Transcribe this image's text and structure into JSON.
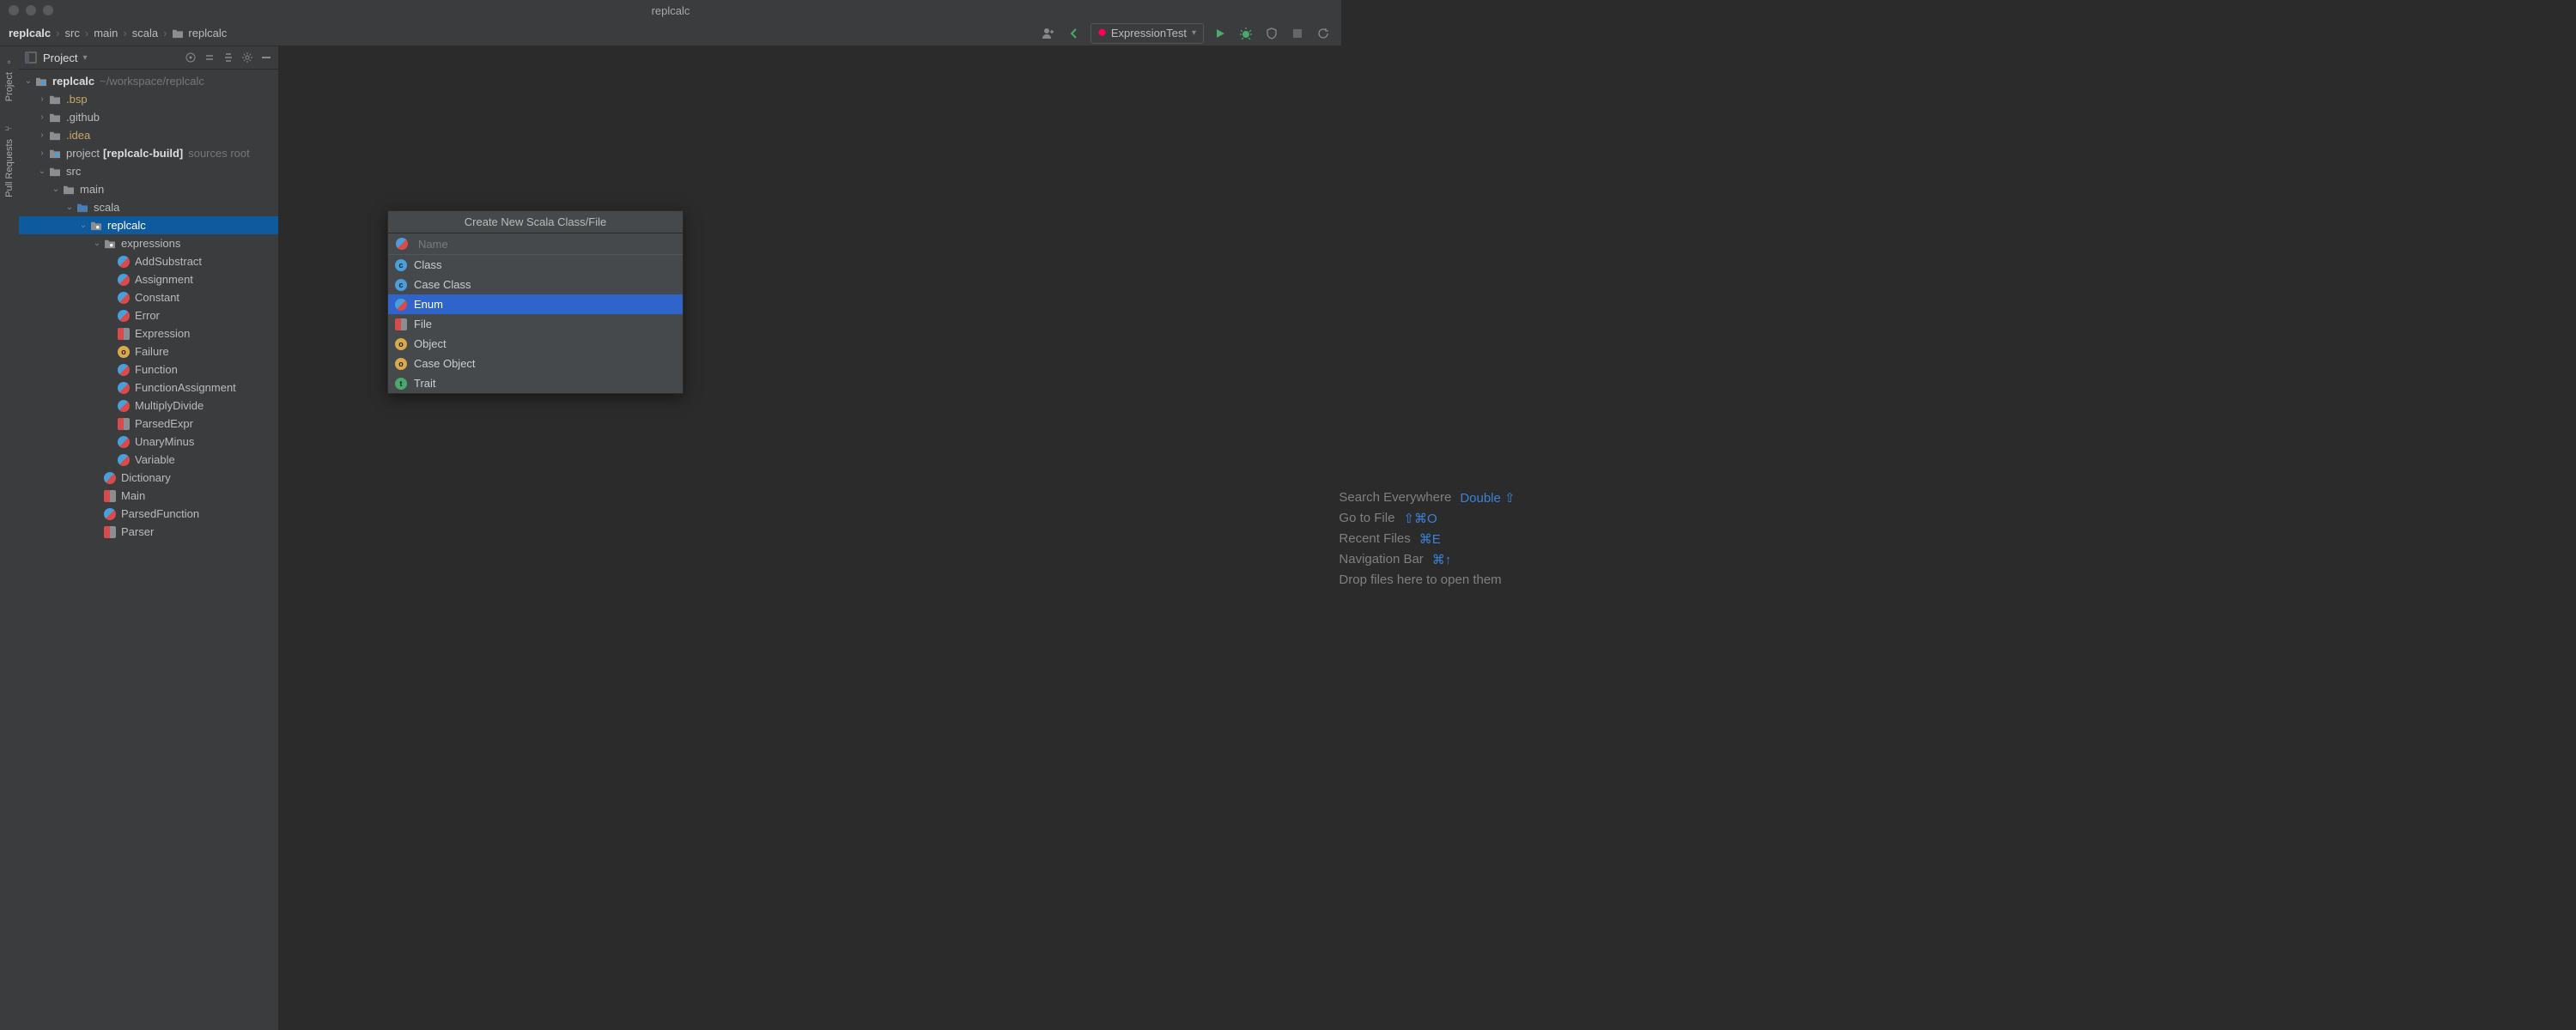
{
  "window": {
    "title": "replcalc"
  },
  "breadcrumb": [
    "replcalc",
    "src",
    "main",
    "scala",
    "replcalc"
  ],
  "run_config": {
    "label": "ExpressionTest"
  },
  "gutter": {
    "project": "Project",
    "pull_requests": "Pull Requests"
  },
  "project_pane": {
    "title": "Project",
    "root": {
      "name": "replcalc",
      "path": "~/workspace/replcalc"
    },
    "nodes": {
      "bsp": ".bsp",
      "github": ".github",
      "idea": ".idea",
      "project": "project",
      "project_bold": "[replcalc-build]",
      "project_hint": "sources root",
      "src": "src",
      "main": "main",
      "scala": "scala",
      "pkg": "replcalc",
      "expressions": "expressions",
      "files": {
        "AddSubstract": "AddSubstract",
        "Assignment": "Assignment",
        "Constant": "Constant",
        "Error": "Error",
        "Expression": "Expression",
        "Failure": "Failure",
        "Function": "Function",
        "FunctionAssignment": "FunctionAssignment",
        "MultiplyDivide": "MultiplyDivide",
        "ParsedExpr": "ParsedExpr",
        "UnaryMinus": "UnaryMinus",
        "Variable": "Variable"
      },
      "Dictionary": "Dictionary",
      "Main": "Main",
      "ParsedFunction": "ParsedFunction",
      "Parser": "Parser"
    }
  },
  "popup": {
    "title": "Create New Scala Class/File",
    "placeholder": "Name",
    "items": {
      "class": "Class",
      "case_class": "Case Class",
      "enum": "Enum",
      "file": "File",
      "object": "Object",
      "case_object": "Case Object",
      "trait": "Trait"
    },
    "selected": "enum"
  },
  "welcome": {
    "search": "Search Everywhere",
    "search_key": "Double ⇧",
    "goto": "Go to File",
    "goto_key": "⇧⌘O",
    "recent": "Recent Files",
    "recent_key": "⌘E",
    "nav": "Navigation Bar",
    "nav_key": "⌘↑",
    "drop": "Drop files here to open them"
  }
}
